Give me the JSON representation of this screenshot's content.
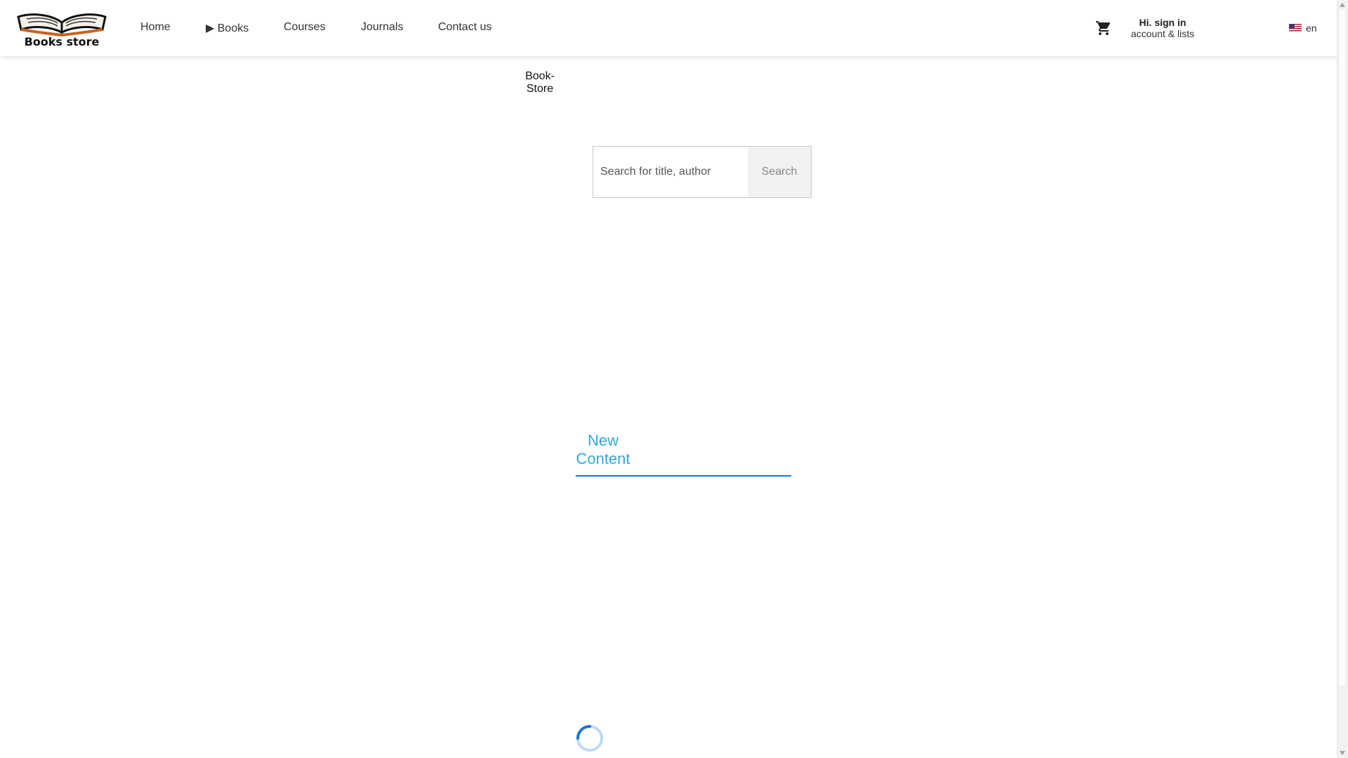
{
  "header": {
    "logo": {
      "text": "Books store",
      "icon": "open-book-icon"
    },
    "nav": {
      "home": "Home",
      "books": "▶ Books",
      "courses": "Courses",
      "journals": "Journals",
      "contact": "Contact us"
    },
    "cart": {
      "icon": "shopping-cart-icon"
    },
    "account": {
      "line1": "Hi. sign in",
      "line2": "account & lists"
    },
    "language": {
      "flag": "us-flag-icon",
      "code": "en"
    }
  },
  "brand": {
    "text": "Book-Store"
  },
  "search": {
    "placeholder": "Search for title, author",
    "button": "Search"
  },
  "section": {
    "title": "New Content"
  },
  "colors": {
    "accent": "#1976d2",
    "section_title": "#35a8d8",
    "spinner": "#1976d2"
  }
}
